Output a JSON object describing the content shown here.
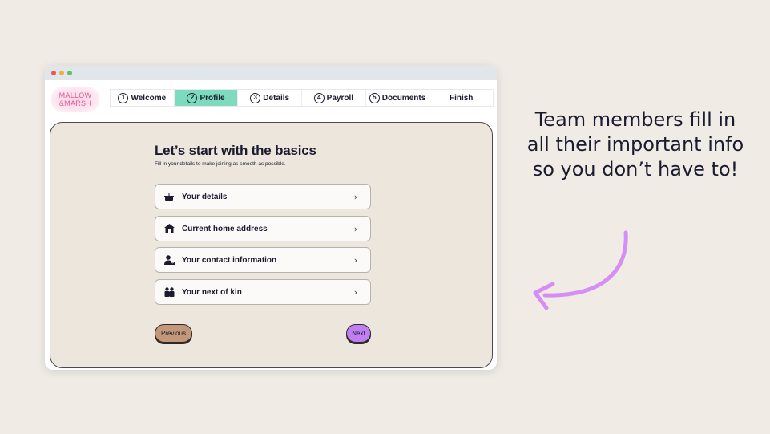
{
  "window": {
    "traffic_lights": [
      "close",
      "minimize",
      "maximize"
    ]
  },
  "header": {
    "logo_line1": "MALLOW",
    "logo_line2": "&MARSH",
    "steps": [
      {
        "num": "1",
        "label": "Welcome",
        "active": false
      },
      {
        "num": "2",
        "label": "Profile",
        "active": true
      },
      {
        "num": "3",
        "label": "Details",
        "active": false
      },
      {
        "num": "4",
        "label": "Payroll",
        "active": false
      },
      {
        "num": "5",
        "label": "Documents",
        "active": false
      },
      {
        "num": "",
        "label": "Finish",
        "active": false
      }
    ]
  },
  "main": {
    "title": "Let’s start with the basics",
    "subtitle": "Fill in your details to make joining as smooth as possible.",
    "cards": [
      {
        "icon": "cake-icon",
        "label": "Your details"
      },
      {
        "icon": "home-icon",
        "label": "Current home address"
      },
      {
        "icon": "contact-icon",
        "label": "Your contact information"
      },
      {
        "icon": "people-icon",
        "label": "Your next of kin"
      }
    ],
    "previous_label": "Previous",
    "next_label": "Next"
  },
  "callout": {
    "text": "Team members fill in all their important info so you don’t have to!"
  },
  "colors": {
    "background": "#f0ebe5",
    "active_step": "#7ddbbd",
    "panel": "#ece6dd",
    "previous_button": "#c4977a",
    "next_button": "#c07ef2",
    "arrow": "#d68ef5",
    "logo": "#e2579a"
  }
}
